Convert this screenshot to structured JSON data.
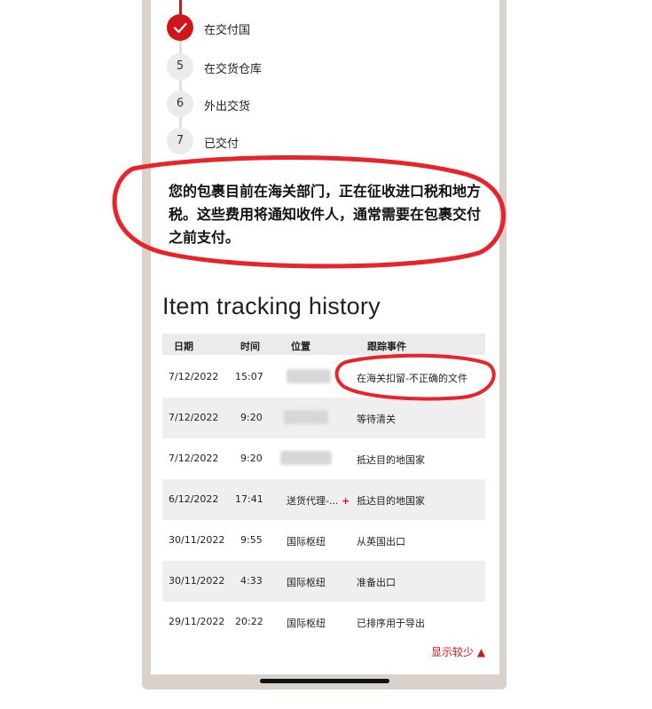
{
  "steps": [
    {
      "number": "",
      "label": "在交付国",
      "done": true
    },
    {
      "number": "5",
      "label": "在交货仓库",
      "done": false
    },
    {
      "number": "6",
      "label": "外出交货",
      "done": false
    },
    {
      "number": "7",
      "label": "已交付",
      "done": false
    }
  ],
  "notice": "您的包裹目前在海关部门，正在征收进口税和地方税。这些费用将通知收件人，通常需要在包裹交付之前支付。",
  "history": {
    "title": "Item tracking history",
    "columns": [
      "日期",
      "时间",
      "位置",
      "跟踪事件"
    ],
    "rows": [
      {
        "date": "7/12/2022",
        "time": "15:07",
        "location": "",
        "event": "在海关扣留-不正确的文件"
      },
      {
        "date": "7/12/2022",
        "time": "9:20",
        "location": "",
        "event": "等待清关"
      },
      {
        "date": "7/12/2022",
        "time": "9:20",
        "location": "",
        "event": "抵达目的地国家"
      },
      {
        "date": "6/12/2022",
        "time": "17:41",
        "location": "送货代理-...",
        "event": "抵达目的地国家"
      },
      {
        "date": "30/11/2022",
        "time": "9:55",
        "location": "国际枢纽",
        "event": "从英国出口"
      },
      {
        "date": "30/11/2022",
        "time": "4:33",
        "location": "国际枢纽",
        "event": "准备出口"
      },
      {
        "date": "29/11/2022",
        "time": "20:22",
        "location": "国际枢纽",
        "event": "已排序用于导出"
      }
    ],
    "show_less": "显示较少 ▲"
  },
  "colors": {
    "accent": "#d0151b",
    "annotation": "#e8232a"
  }
}
